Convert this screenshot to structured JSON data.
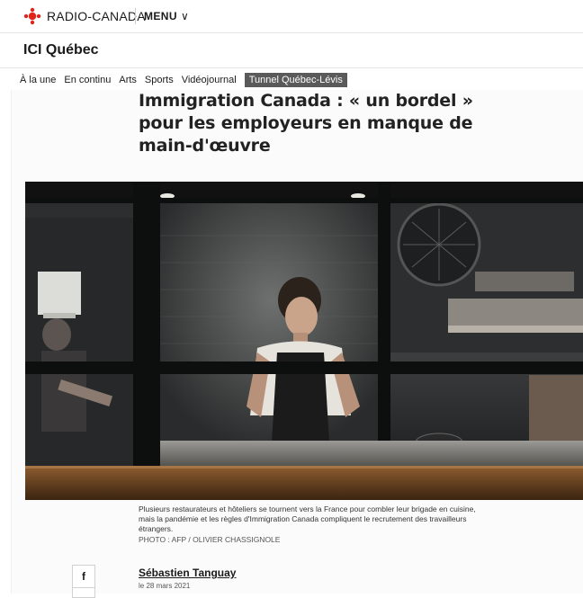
{
  "header": {
    "brand": "RADIO-CANADA",
    "menu_label": "MENU",
    "menu_chevron": "∨"
  },
  "region": {
    "title": "ICI Québec"
  },
  "nav": {
    "items": [
      {
        "label": "À la une"
      },
      {
        "label": "En continu"
      },
      {
        "label": "Arts"
      },
      {
        "label": "Sports"
      },
      {
        "label": "Vidéojournal"
      },
      {
        "label": "Tunnel Québec-Lévis",
        "active": true
      }
    ]
  },
  "article": {
    "headline_line1": "Immigration Canada : « un bordel »",
    "headline_line2": "pour les employeurs en manque de",
    "headline_line3": "main-d'œuvre",
    "caption": "Plusieurs restaurateurs et hôteliers se tournent vers la France pour combler leur brigade en cuisine, mais la pandémie et les règles d'Immigration Canada compliquent le recrutement des travailleurs étrangers.",
    "photo_credit": "PHOTO : AFP / OLIVIER CHASSIGNOLE",
    "author": "Sébastien Tanguay",
    "date": "le 28 mars 2021"
  },
  "share": {
    "facebook_label": "f"
  },
  "colors": {
    "brand_red": "#e1251b",
    "nav_active_bg": "#5a5a5a"
  }
}
